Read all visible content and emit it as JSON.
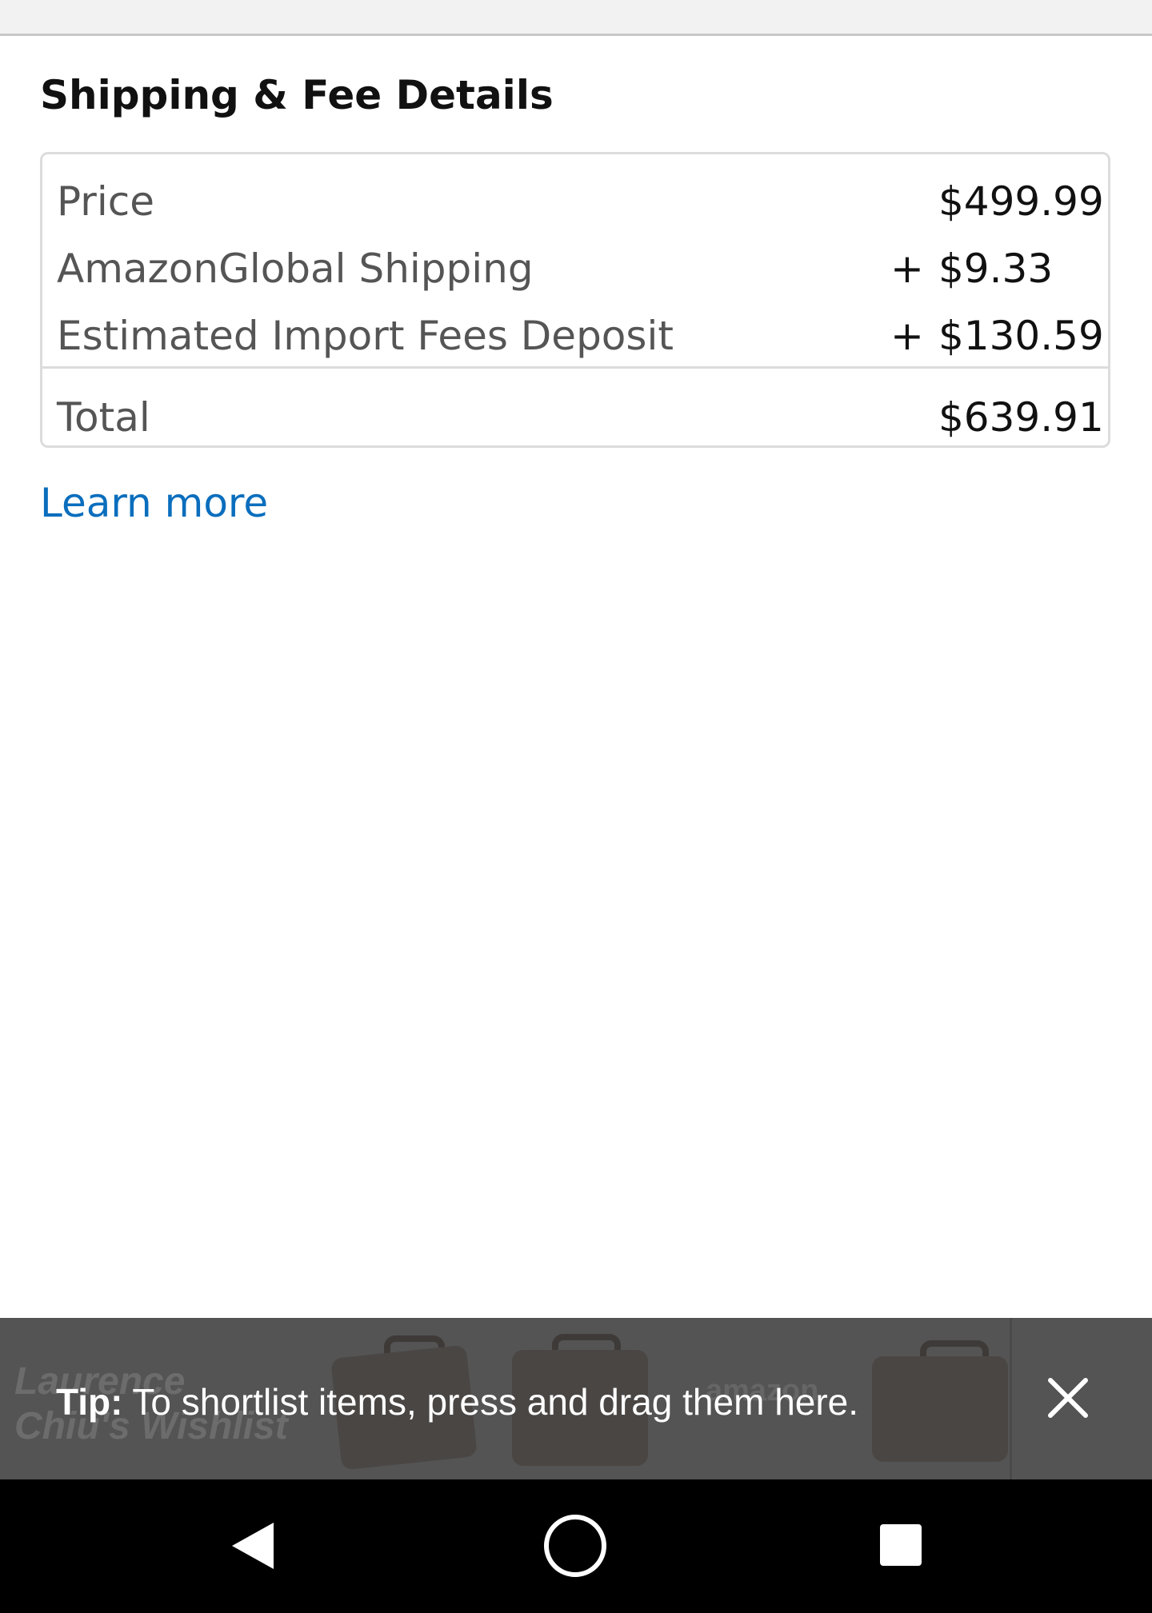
{
  "shipping_fee": {
    "title": "Shipping & Fee Details",
    "rows": [
      {
        "label": "Price",
        "sign": "",
        "amount": "$499.99"
      },
      {
        "label": "AmazonGlobal Shipping",
        "sign": "+",
        "amount": "$9.33"
      },
      {
        "label": "Estimated Import Fees Deposit",
        "sign": "+",
        "amount": "$130.59"
      }
    ],
    "total": {
      "label": "Total",
      "amount": "$639.91"
    },
    "learn_more": "Learn more"
  },
  "wishlist_bar": {
    "background_title": "Laurence Chiu's Wishlist",
    "background_logo": "amazon",
    "tip_prefix": "Tip:",
    "tip_text": " To shortlist items, press and drag them here.",
    "close_icon": "close-icon"
  },
  "nav": {
    "back_icon": "back-triangle-icon",
    "home_icon": "home-circle-icon",
    "recents_icon": "recents-square-icon"
  },
  "colors": {
    "link": "#0a6ebd",
    "tip_bar": "#545454",
    "nav_bar": "#000000"
  }
}
